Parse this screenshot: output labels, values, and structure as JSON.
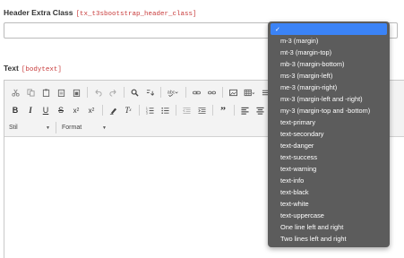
{
  "header_extra_class": {
    "label": "Header Extra Class",
    "field_code": "[tx_t3sbootstrap_header_class]",
    "value": ""
  },
  "text_field": {
    "label": "Text",
    "field_code": "[bodytext]"
  },
  "toolbar": {
    "style_combo": "Stil",
    "format_combo": "Format"
  },
  "dropdown": {
    "selected_mark": "✓",
    "options": [
      "m-3 (margin)",
      "mt-3 (margin-top)",
      "mb-3 (margin-bottom)",
      "ms-3 (margin-left)",
      "me-3 (margin-right)",
      "mx-3 (margin-left and -right)",
      "my-3 (margin-top and -bottom)",
      "text-primary",
      "text-secondary",
      "text-danger",
      "text-success",
      "text-warning",
      "text-info",
      "text-black",
      "text-white",
      "text-uppercase",
      "One line left and right",
      "Two lines left and right"
    ]
  },
  "colors": {
    "dropdown_bg": "#5c5c5c",
    "selected_bg": "#3b83f6",
    "field_code": "#c83c3c"
  },
  "icons": {
    "row1": [
      "cut-icon",
      "copy-icon",
      "paste-icon",
      "paste-text-icon",
      "paste-word-icon",
      "undo-icon",
      "redo-icon",
      "find-icon",
      "replace-icon",
      "spellcheck-icon",
      "link-icon",
      "unlink-icon",
      "image-icon",
      "table-icon",
      "horizontal-rule-icon",
      "special-char-icon"
    ],
    "row2": [
      "bold-icon",
      "italic-icon",
      "underline-icon",
      "strikethrough-icon",
      "subscript-icon",
      "superscript-icon",
      "remove-format-icon",
      "clear-format-icon",
      "numbered-list-icon",
      "bullet-list-icon",
      "outdent-icon",
      "indent-icon",
      "blockquote-icon",
      "align-left-icon",
      "align-center-icon",
      "align-right-icon"
    ]
  }
}
